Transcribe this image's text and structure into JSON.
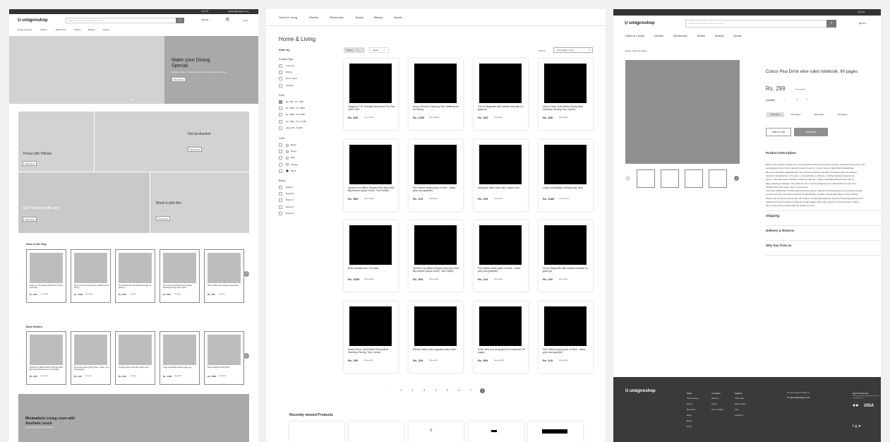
{
  "brand": "uniqproshop",
  "currency": "INR",
  "support_email": "support@uniqpro.com",
  "search_placeholder": "Search for products, brand and more",
  "login": "Login",
  "nav": [
    "Home & Living",
    "Kitchen",
    "Electronics",
    "Books",
    "Beauty",
    "Sports"
  ],
  "home": {
    "hero_title": "Make your Dining Special",
    "hero_sub": "Finding a party or hosting a brunch, this best place for you.",
    "shop_now": "Shop Now",
    "promos": [
      "Throw with Pillows",
      "Get productive",
      "Safe Trekking with care",
      "Blush it with this"
    ],
    "deal_title": "Deal of the Day",
    "deals": [
      {
        "name": "Judge by TTK Prestige Aluminium Fry Pan, 2psm Red",
        "price": "Rs. 949",
        "mrp": "Rs. 1500"
      },
      {
        "name": "Krica a Person Camping Tent, Waterproof for fishing",
        "price": "Rs. 1290",
        "mrp": "Rs. 1999"
      },
      {
        "name": "French Baguette with Vanilla essential oil, glass jar",
        "price": "Rs. 299",
        "mrp": "Rs. 449"
      },
      {
        "name": "Home Decor Gold Metal Glossy Blue Stacking Serving Tray 3-piece",
        "price": "Rs. 289",
        "mrp": "Rs. 399"
      },
      {
        "name": "Kitchen table plate organizer pale white",
        "price": "Rs. 159",
        "mrp": "Rs. 229"
      }
    ],
    "best_title": "Best Sellers",
    "best": [
      {
        "name": "Spotzero by Milton Elegant Spin Mop With Big wheels (Aqua Green, Two Refills)",
        "price": "Rs. 959",
        "mrp": "Rs. 1299"
      },
      {
        "name": "Fizz netted mask (pack of three - black, grey and graphite)",
        "price": "Rs. 129",
        "mrp": "Rs. 299"
      },
      {
        "name": "Analogue desk clock with copper coat",
        "price": "Rs. 299",
        "mrp": "Rs. 449"
      },
      {
        "name": "Large camouflage trekking bag, grey",
        "price": "Rs. 1389",
        "mrp": "Rs. 2199"
      },
      {
        "name": "Bose headphones CR black",
        "price": "Rs. 1599",
        "mrp": "Rs. 2999"
      }
    ],
    "banner_title": "Minimalistic Living room with Aesthetic touch",
    "banner_sub": "Great feeling in touch needed"
  },
  "listing": {
    "title": "Home & Living",
    "filter_by": "Filter by",
    "filter_chips": [
      "Dining",
      "Green"
    ],
    "sort_label": "Sort by",
    "sort_value": "Price High to Low",
    "product_type_title": "Product Type",
    "product_types": [
      "Furniture",
      "Dining",
      "Room decor",
      "Lifestyle"
    ],
    "price_title": "Price",
    "prices": [
      "Rs. 499 - Rs. 1999",
      "Rs. 1999 - Rs. 4999",
      "Rs. 4999 - Rs. 7999",
      "Rs. 7999 - Rs. 11,999",
      "Above Rs. 11,999"
    ],
    "price_checked": 0,
    "color_title": "Color",
    "colors": [
      "Beige",
      "Green",
      "Blue",
      "Orange",
      "Black"
    ],
    "brand_title": "Brand",
    "brands": [
      "Brand A",
      "Brand B",
      "Brand C",
      "Brand D",
      "Brand E"
    ],
    "products": [
      {
        "name": "Judge by TTK Prestige Aluminium Fry Pan, 2psm Red",
        "price": "Rs. 949",
        "mrp": "Rs. 1500"
      },
      {
        "name": "Krica a Person Camping Tent, Waterproof for fishing",
        "price": "Rs. 1290",
        "mrp": "Rs. 1999"
      },
      {
        "name": "French Baguette with Vanilla essential oil, glass jar",
        "price": "Rs. 299",
        "mrp": "Rs. 449"
      },
      {
        "name": "Home Decor Gold Metal Glossy Blue Stacking Serving Tray 3-piece",
        "price": "Rs. 289",
        "mrp": "Rs. 399"
      },
      {
        "name": "Spotzero by Milton Elegant Spin Mop With Big wheels (Aqua Green, Two Refills)",
        "price": "Rs. 959",
        "mrp": "Rs. 1299"
      },
      {
        "name": "Fizz netted mask (pack of three - black, grey and graphite)",
        "price": "Rs. 129",
        "mrp": "Rs. 299"
      },
      {
        "name": "Analogue desk clock with copper coat",
        "price": "Rs. 299",
        "mrp": "Rs. 449"
      },
      {
        "name": "Large camouflage trekking bag, grey",
        "price": "Rs. 1389",
        "mrp": "Rs. 2199"
      },
      {
        "name": "Bose headphones CR black",
        "price": "Rs. 1599",
        "mrp": "Rs. 2999"
      },
      {
        "name": "Spotzero by Milton Elegant Spin Mop With Big wheels (Aqua Green, Two Refills)",
        "price": "Rs. 959",
        "mrp": "Rs. 1299"
      },
      {
        "name": "Fizz netted mask (pack of three - black, grey and graphite)",
        "price": "Rs. 129",
        "mrp": "Rs. 299"
      },
      {
        "name": "French Baguette with Vanilla essential oil, glass jar",
        "price": "Rs. 299",
        "mrp": "Rs. 449"
      },
      {
        "name": "Home Decor Gold Metal Glossy Blue Stacking Serving Tray 3-piece",
        "price": "Rs. 289",
        "mrp": "Rs. 399"
      },
      {
        "name": "Kitchen table plate organizer pale white",
        "price": "Rs. 159",
        "mrp": "Rs. 229"
      },
      {
        "name": "Drink wine pop art graphic A4 notebook, 80 pages",
        "price": "Rs. 959",
        "mrp": "Rs. 1299"
      },
      {
        "name": "Fizz netted mask (pack of three - black, grey and graphite)",
        "price": "Rs. 129",
        "mrp": "Rs. 299"
      }
    ],
    "pages": [
      "1",
      "2",
      "3",
      "4",
      "5",
      "6",
      "7"
    ],
    "current_page": 0,
    "recent_title": "Recently viewed Products"
  },
  "detail": {
    "breadcrumb": "Home / Home & Living",
    "title": "Colour Plus Drink wine ruled notebook, 80 pages",
    "price": "Rs. 299",
    "mrp": "Rs. 449",
    "quantity_label": "Quantity",
    "quantity": "1",
    "variants": [
      "80 pages",
      "120 pages",
      "180 pages",
      "240 pages"
    ],
    "variant_selected": 0,
    "add_to_cart": "Add to Cart",
    "buy_now": "Buy Now",
    "desc_title": "Product Description",
    "desc_lines": [
      "Built to Last! Highest Quality from Tovic Anodized Aluminum Camping Cookset conducts heat evenly. This",
      "survival gear that is built to last and is perfect tool for 1 youth scout or adult hiker backpacking.",
      "All-in-one Cookware Mega Bundle: The 10 Piece Camping Campfire Cookware Mess Kit includes",
      "Aluminum Nonstick Pot + Pot Cover + Nonstick Pan + 2 Bowls + Folding Stainless Steel Spork,",
      "Spoon + Wooden Spoon Spatula + Cleaning Sponge + Nylon Travel Bag Drawstring Pouch for",
      "Easy Cleaning & Storage. The entire 10 piece mess kit collapses into small bundle for easy carry",
      "(Weighs Only 4 lbs clean, keep it convenient!",
      "Tovic Free Wilderness: Finally enjoy the great outdoors without second guessing if you packed enough",
      "to cook and serve your best meal with the lightweight, compact, and durable design of the Cookset.",
      "Perfect Gift for Family and Friends: #1 Outdoor Cooking Backpacking Gear and Camping Equipment for",
      "Hiking Picnic Set for anyone looking for a high quality, great value product for the camping or hiking",
      "bag to enjoy at the cookout with the people you love."
    ],
    "sections": [
      "Shipping",
      "Delivery & Returns",
      "Why buy from us"
    ],
    "footer": {
      "shop_title": "Shop",
      "shop": [
        "Home & Living",
        "Kitchen",
        "Electronics",
        "Books",
        "Beauty",
        "Sports"
      ],
      "company_title": "Company",
      "company": [
        "About Us",
        "Privacy",
        "Terms of Policy"
      ],
      "support_title": "Support",
      "support": [
        "Track order",
        "Refund Policy",
        "FAQ",
        "Contact Us"
      ],
      "contact_label": "For more queries Contact us",
      "payment_title": "Secure Payment",
      "payment_sub": "We accept all major cards, your information is well protected",
      "visa": "VISA"
    }
  }
}
